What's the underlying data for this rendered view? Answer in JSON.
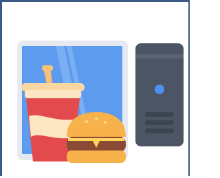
{
  "icon": {
    "name": "computer-and-fast-food-icon",
    "parts": [
      "monitor-icon",
      "pc-tower-icon",
      "soda-cup-icon",
      "burger-icon"
    ]
  },
  "colors": {
    "frame_border": "#3c5a86",
    "monitor_bezel": "#e6eaf0",
    "monitor_screen": "#5d9bef",
    "tower_body": "#4c5563",
    "tower_light": "#4f8ff0",
    "cup_red": "#e24a4d",
    "cup_cream": "#fde7c3",
    "straw": "#f6c076",
    "bun": "#f7b24b",
    "patty": "#8a4a33",
    "cheese": "#ffd45c"
  }
}
